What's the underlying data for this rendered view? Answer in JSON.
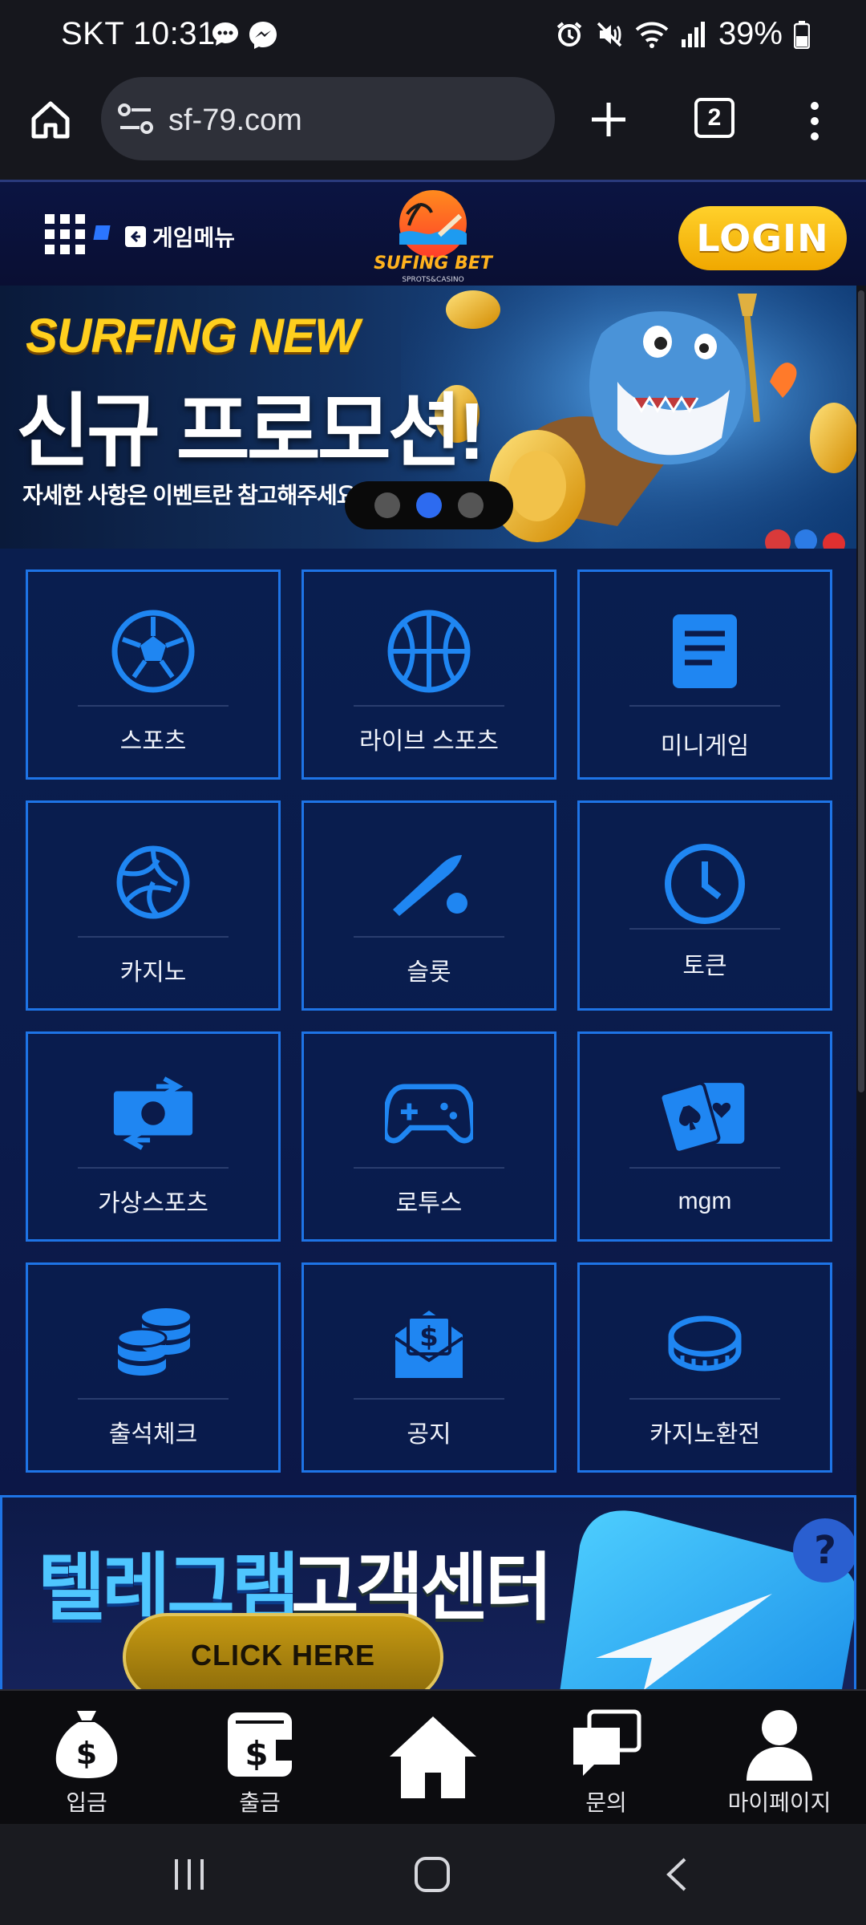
{
  "status_bar": {
    "carrier_time": "SKT 10:31",
    "battery": "39%",
    "icons": [
      "chat-bubble-icon",
      "messenger-icon",
      "alarm-icon",
      "mute-icon",
      "wifi-icon",
      "signal-icon",
      "battery-icon"
    ]
  },
  "browser": {
    "url": "sf-79.com",
    "tab_count": "2"
  },
  "header": {
    "game_menu_label": "게임메뉴",
    "logo_text": "SUFING BET",
    "logo_subtext": "SPROTS&CASINO",
    "login_label": "LOGIN"
  },
  "banner": {
    "line1": "SURFING NEW",
    "line2": "신규 프로모션!",
    "line3": "자세한 사항은 이벤트란 참고해주세요.",
    "slides": 3,
    "active_slide": 2
  },
  "menu_tiles": [
    {
      "label": "스포츠",
      "icon": "soccer-ball-icon"
    },
    {
      "label": "라이브 스포츠",
      "icon": "basketball-icon"
    },
    {
      "label": "미니게임",
      "icon": "document-icon"
    },
    {
      "label": "카지노",
      "icon": "volleyball-icon"
    },
    {
      "label": "슬롯",
      "icon": "baseball-bat-icon"
    },
    {
      "label": "토큰",
      "icon": "clock-icon"
    },
    {
      "label": "가상스포츠",
      "icon": "money-exchange-icon"
    },
    {
      "label": "로투스",
      "icon": "gamepad-icon"
    },
    {
      "label": "mgm",
      "icon": "playing-cards-icon"
    },
    {
      "label": "출석체크",
      "icon": "coin-stack-icon"
    },
    {
      "label": "공지",
      "icon": "money-envelope-icon"
    },
    {
      "label": "카지노환전",
      "icon": "coin-icon"
    }
  ],
  "telegram_banner": {
    "title_part1": "텔레그램",
    "title_part2": "고객센터",
    "button_label": "CLICK HERE"
  },
  "bottom_nav": [
    {
      "label": "입금",
      "icon": "money-bag-icon"
    },
    {
      "label": "출금",
      "icon": "wallet-icon"
    },
    {
      "label": "",
      "icon": "home-icon"
    },
    {
      "label": "문의",
      "icon": "chat-icon"
    },
    {
      "label": "마이페이지",
      "icon": "user-icon"
    }
  ],
  "colors": {
    "tile_border": "#1e74e6",
    "icon_blue": "#1f86f2",
    "login_yellow": "#ffd12b",
    "page_bg": "#0a1e4e"
  }
}
